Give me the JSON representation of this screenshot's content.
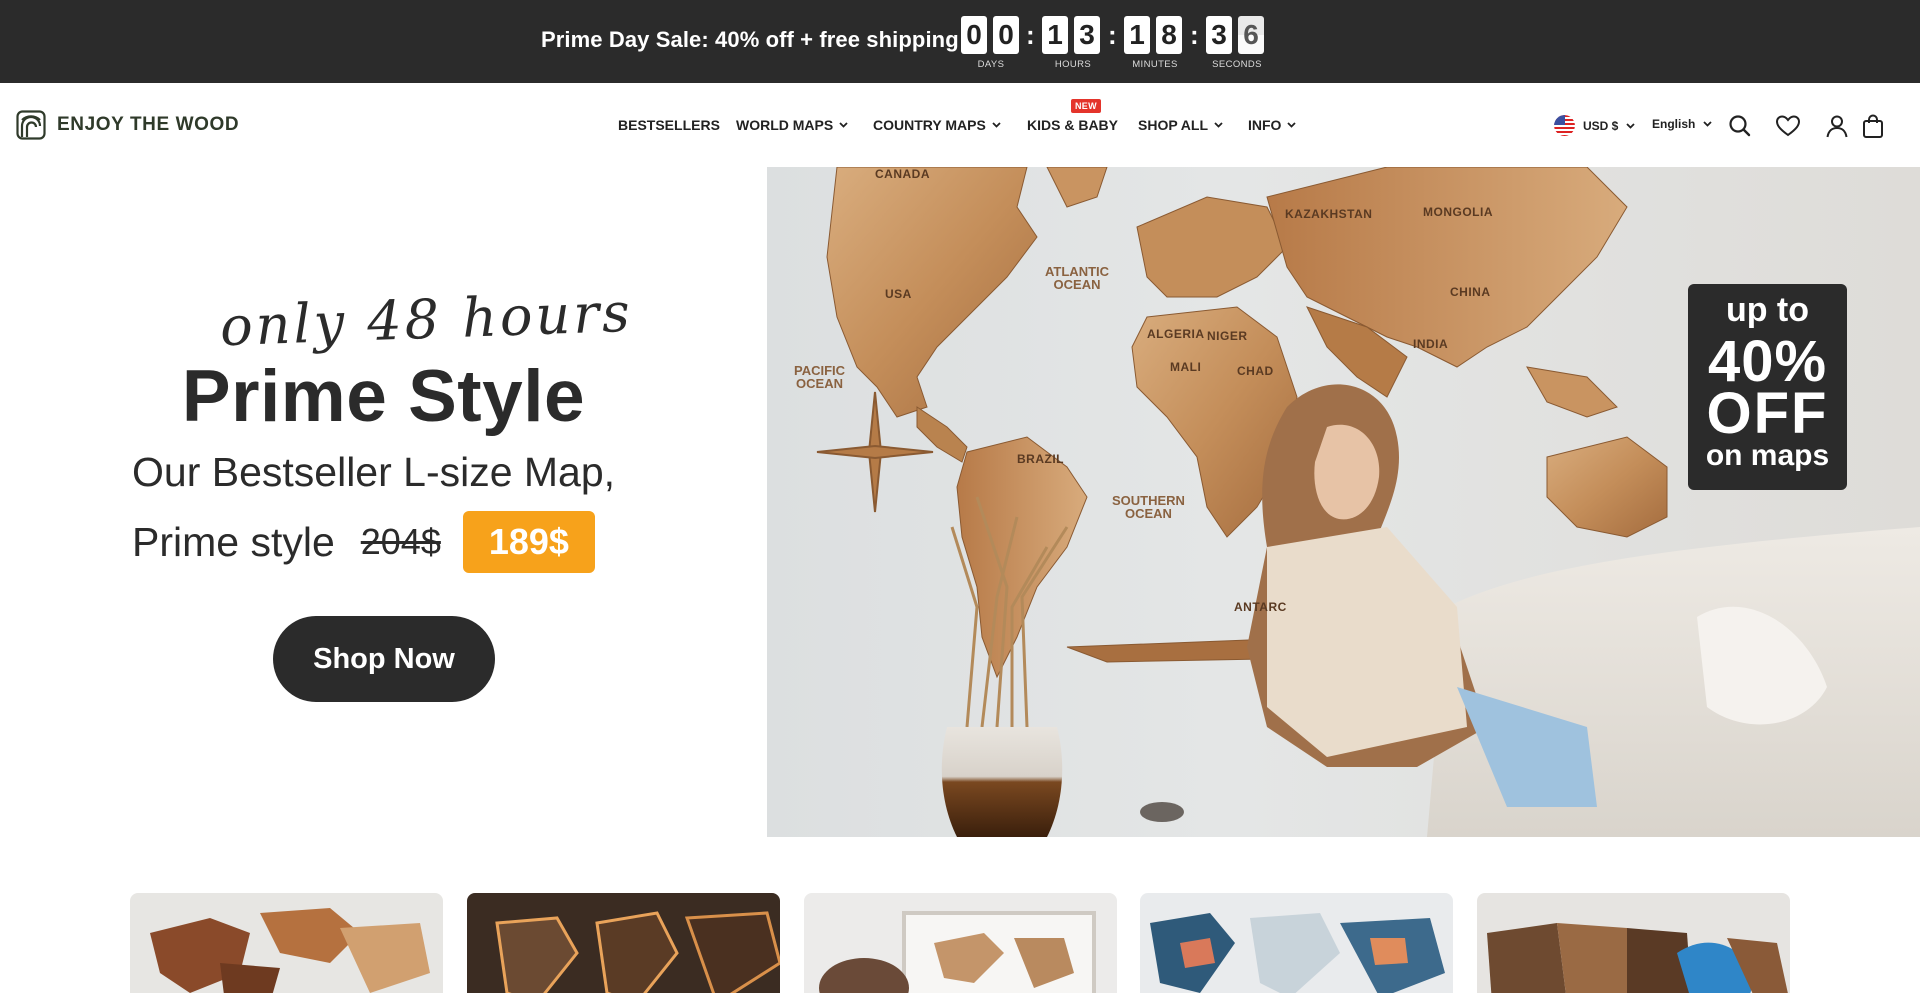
{
  "announcement": {
    "promo_text": "Prime Day Sale: 40% off  + free shipping",
    "countdown": {
      "days": [
        "0",
        "0"
      ],
      "hours": [
        "1",
        "3"
      ],
      "minutes": [
        "1",
        "8"
      ],
      "seconds": [
        "3",
        "6"
      ],
      "separator": ":",
      "labels": {
        "days": "DAYS",
        "hours": "HOURS",
        "minutes": "MINUTES",
        "seconds": "SECONDS"
      }
    }
  },
  "header": {
    "logo_text": "ENJOY THE WOOD",
    "nav": [
      {
        "label": "BESTSELLERS",
        "dropdown": false
      },
      {
        "label": "WORLD MAPS",
        "dropdown": true
      },
      {
        "label": "COUNTRY MAPS",
        "dropdown": true
      },
      {
        "label": "KIDS & BABY",
        "dropdown": false,
        "badge": "NEW"
      },
      {
        "label": "SHOP ALL",
        "dropdown": true
      },
      {
        "label": "INFO",
        "dropdown": true
      }
    ],
    "currency": "USD $",
    "language": "English",
    "icons": [
      "search-icon",
      "wishlist-heart-icon",
      "account-icon",
      "cart-bag-icon"
    ]
  },
  "hero": {
    "script_line": "only 48 hours",
    "title": "Prime Style",
    "subtitle": "Our Bestseller L-size Map,",
    "line2_text": "Prime style",
    "old_price": "204$",
    "new_price": "189$",
    "cta": "Shop Now",
    "offer": {
      "line1": "up to",
      "line2": "40%",
      "line3": "OFF",
      "line4": "on maps"
    },
    "map_labels": {
      "canada": "CANADA",
      "usa": "USA",
      "brazil": "BRAZIL",
      "china": "CHINA",
      "india": "INDIA",
      "kazakhstan": "KAZAKHSTAN",
      "mongolia": "MONGOLIA",
      "algeria": "ALGERIA",
      "niger": "NIGER",
      "chad": "CHAD",
      "mali": "MALI",
      "atlantic": "ATLANTIC\nOCEAN",
      "pacific": "PACIFIC\nOCEAN",
      "southern": "SOUTHERN\nOCEAN",
      "antarctica": "ANTARC"
    }
  },
  "colors": {
    "dark": "#2b2b2b",
    "price_accent": "#f7a21b",
    "badge_red": "#e4342b",
    "wood_light": "#d6a877",
    "wood_mid": "#c28a57",
    "wood_dark": "#8e5a33"
  }
}
